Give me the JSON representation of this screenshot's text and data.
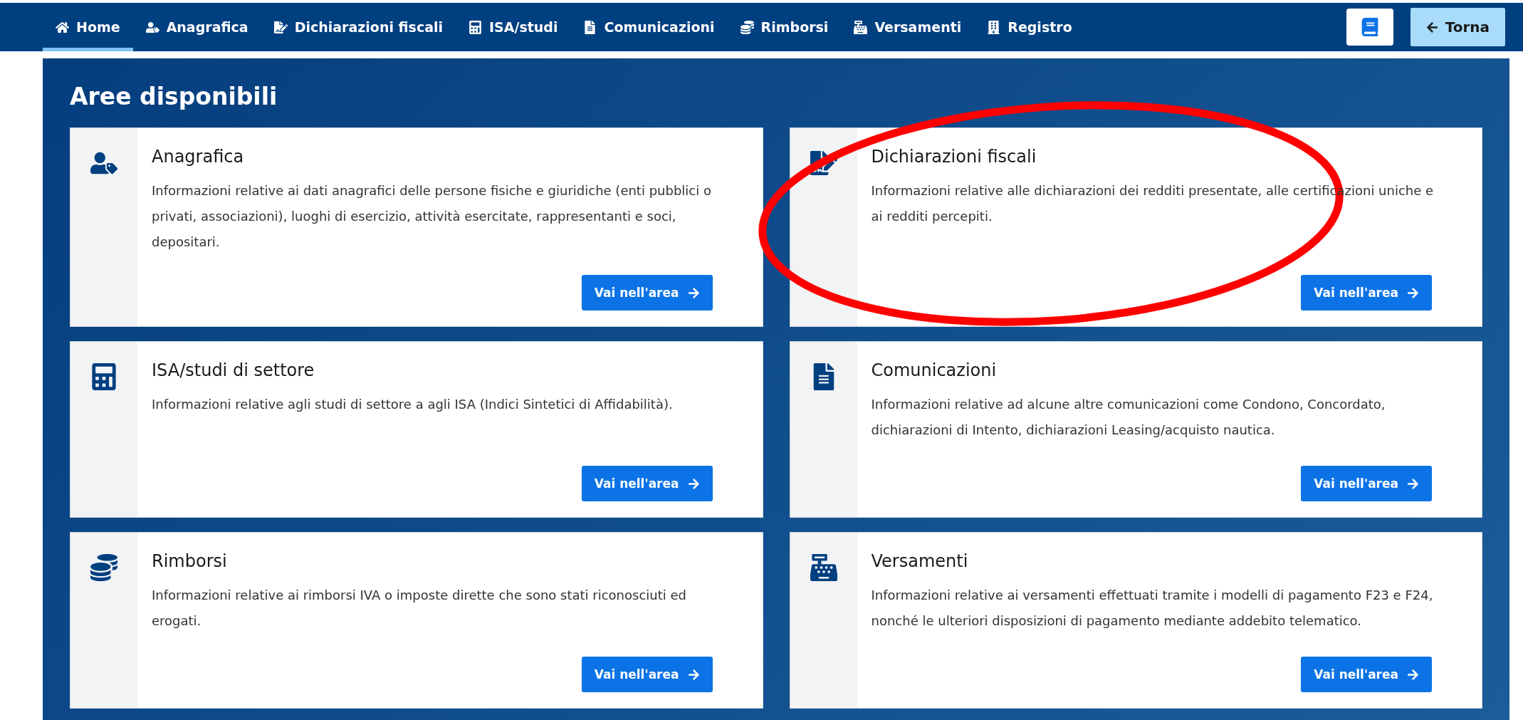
{
  "nav": {
    "items": [
      {
        "label": "Home",
        "selected": true
      },
      {
        "label": "Anagrafica",
        "selected": false
      },
      {
        "label": "Dichiarazioni fiscali",
        "selected": false
      },
      {
        "label": "ISA/studi",
        "selected": false
      },
      {
        "label": "Comunicazioni",
        "selected": false
      },
      {
        "label": "Rimborsi",
        "selected": false
      },
      {
        "label": "Versamenti",
        "selected": false
      },
      {
        "label": "Registro",
        "selected": false
      }
    ],
    "back_button": "Torna"
  },
  "title": "Aree disponibili",
  "cards": [
    {
      "title": "Anagrafica",
      "description": "Informazioni relative ai dati anagrafici delle persone fisiche e giuridiche (enti pubblici o privati, associazioni), luoghi di esercizio, attività esercitate, rappresentanti e soci, depositari.",
      "button": "Vai nell'area"
    },
    {
      "title": "Dichiarazioni fiscali",
      "description": "Informazioni relative alle dichiarazioni dei redditi presentate, alle certificazioni uniche e ai redditi percepiti.",
      "button": "Vai nell'area"
    },
    {
      "title": "ISA/studi di settore",
      "description": "Informazioni relative agli studi di settore a agli ISA (Indici Sintetici di Affidabilità).",
      "button": "Vai nell'area"
    },
    {
      "title": "Comunicazioni",
      "description": "Informazioni relative ad alcune altre comunicazioni come Condono, Concordato, dichiarazioni di Intento, dichiarazioni Leasing/acquisto nautica.",
      "button": "Vai nell'area"
    },
    {
      "title": "Rimborsi",
      "description": "Informazioni relative ai rimborsi IVA o imposte dirette che sono stati riconosciuti ed erogati.",
      "button": "Vai nell'area"
    },
    {
      "title": "Versamenti",
      "description": "Informazioni relative ai versamenti effettuati tramite i modelli di pagamento F23 e F24, nonché le ulteriori disposizioni di pagamento mediante addebito telematico.",
      "button": "Vai nell'area"
    }
  ],
  "annotations": [
    {
      "kind": "ellipse"
    }
  ]
}
